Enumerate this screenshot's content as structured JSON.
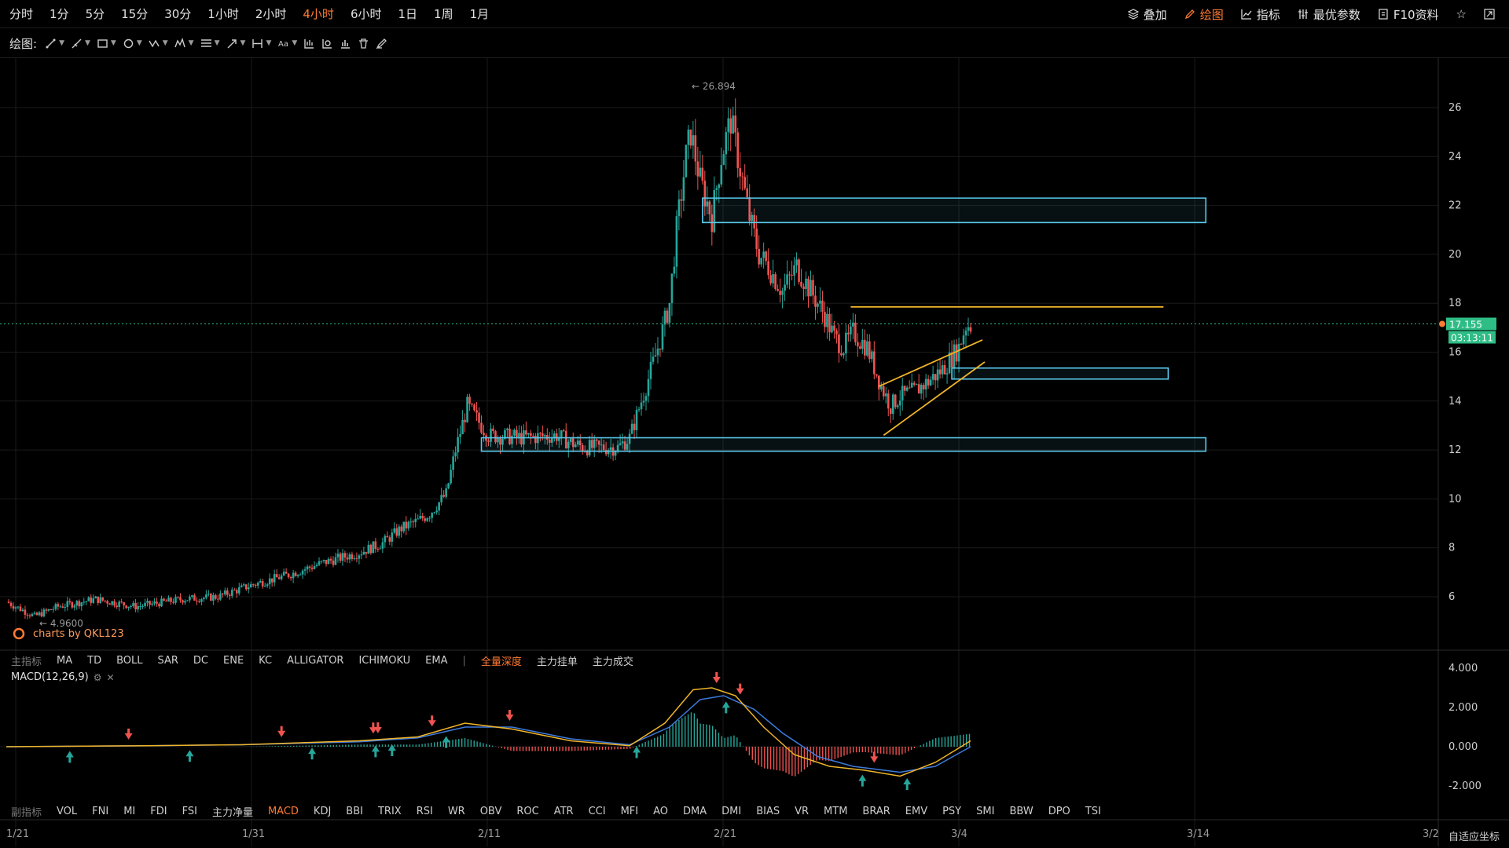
{
  "timeframes": [
    "分时",
    "1分",
    "5分",
    "15分",
    "30分",
    "1小时",
    "2小时",
    "4小时",
    "6小时",
    "1日",
    "1周",
    "1月"
  ],
  "active_timeframe_index": 7,
  "right_tools": [
    {
      "label": "叠加",
      "icon": "layers-icon",
      "active": false
    },
    {
      "label": "绘图",
      "icon": "pen-icon",
      "active": true
    },
    {
      "label": "指标",
      "icon": "indicator-chart-icon",
      "active": false
    },
    {
      "label": "最优参数",
      "icon": "sliders-icon",
      "active": false
    },
    {
      "label": "F10资料",
      "icon": "info-doc-icon",
      "active": false
    }
  ],
  "draw_label": "绘图:",
  "draw_tools": [
    {
      "icon": "line-tool-icon",
      "dropdown": true
    },
    {
      "icon": "ray-tool-icon",
      "dropdown": true
    },
    {
      "icon": "rectangle-tool-icon",
      "dropdown": true
    },
    {
      "icon": "circle-tool-icon",
      "dropdown": true
    },
    {
      "icon": "pattern-tool-icon",
      "dropdown": true
    },
    {
      "icon": "elliott-wave-icon",
      "dropdown": true
    },
    {
      "icon": "fib-tool-icon",
      "dropdown": true
    },
    {
      "icon": "arrow-tool-icon",
      "dropdown": true
    },
    {
      "icon": "measure-tool-icon",
      "dropdown": true
    },
    {
      "icon": "text-tool-icon",
      "label": "Aa",
      "dropdown": true
    },
    {
      "icon": "long-position-icon",
      "dropdown": false
    },
    {
      "icon": "short-position-icon",
      "dropdown": false
    },
    {
      "icon": "bars-pattern-icon",
      "dropdown": false
    },
    {
      "icon": "trash-icon",
      "dropdown": false
    },
    {
      "icon": "brush-icon",
      "dropdown": false
    }
  ],
  "colors": {
    "up": "#26a69a",
    "down": "#ef5350",
    "zone": "#5ac8ea",
    "trend": "#f0b429",
    "accent": "#ff7a33",
    "price": "#2ebd85"
  },
  "chart_data": {
    "type": "candlestick",
    "timeframe": "4小时",
    "x_tick_labels": [
      "1/21",
      "1/31",
      "2/11",
      "2/21",
      "3/4",
      "3/14",
      "3/2"
    ],
    "y_tick_labels": [
      "26",
      "24",
      "22",
      "20",
      "18",
      "16",
      "14",
      "12",
      "10",
      "8",
      "6"
    ],
    "ylim": [
      4.3,
      27.8
    ],
    "last_price": "17.155",
    "countdown": "03:13:11",
    "high_annotation": "26.894",
    "low_annotation": "4.9600",
    "watermark": "charts by QKL123",
    "price_path": [
      [
        0,
        5.8
      ],
      [
        12,
        5.2
      ],
      [
        22,
        5.6
      ],
      [
        38,
        5.9
      ],
      [
        55,
        5.6
      ],
      [
        75,
        5.9
      ],
      [
        90,
        6.0
      ],
      [
        105,
        6.5
      ],
      [
        120,
        6.9
      ],
      [
        135,
        7.4
      ],
      [
        150,
        7.8
      ],
      [
        160,
        8.2
      ],
      [
        168,
        8.8
      ],
      [
        175,
        9.1
      ],
      [
        180,
        9.4
      ],
      [
        187,
        10.2
      ],
      [
        191,
        12.0
      ],
      [
        196,
        13.8
      ],
      [
        205,
        12.6
      ],
      [
        220,
        12.5
      ],
      [
        234,
        12.6
      ],
      [
        240,
        12.3
      ],
      [
        246,
        12.1
      ],
      [
        260,
        12.1
      ],
      [
        265,
        12.5
      ],
      [
        272,
        14.6
      ],
      [
        278,
        16.5
      ],
      [
        282,
        18.0
      ],
      [
        285,
        21.0
      ],
      [
        289,
        24.0
      ],
      [
        291,
        25.0
      ],
      [
        295,
        23.0
      ],
      [
        300,
        21.5
      ],
      [
        304,
        24.0
      ],
      [
        308,
        25.5
      ],
      [
        312,
        23.5
      ],
      [
        316,
        21.5
      ],
      [
        320,
        20.0
      ],
      [
        324,
        19.5
      ],
      [
        330,
        18.5
      ],
      [
        336,
        19.5
      ],
      [
        342,
        18.5
      ],
      [
        348,
        17.5
      ],
      [
        352,
        16.6
      ],
      [
        356,
        16.2
      ],
      [
        360,
        16.8
      ],
      [
        366,
        16.2
      ],
      [
        372,
        14.6
      ],
      [
        376,
        13.8
      ],
      [
        380,
        14.2
      ],
      [
        386,
        14.4
      ],
      [
        392,
        14.8
      ],
      [
        398,
        15.3
      ],
      [
        402,
        15.8
      ],
      [
        405,
        16.2
      ],
      [
        408,
        17.1
      ]
    ],
    "price_path_x_range": [
      0,
      410
    ],
    "overlays": {
      "zones": [
        {
          "x0": 296,
          "x1": 510,
          "y0": 21.3,
          "y1": 22.3
        },
        {
          "x0": 202,
          "x1": 510,
          "y0": 11.95,
          "y1": 12.5
        },
        {
          "x0": 402,
          "x1": 494,
          "y0": 14.9,
          "y1": 15.35
        }
      ],
      "lines": [
        {
          "x0": 359,
          "y0": 17.85,
          "x1": 492,
          "y1": 17.85
        },
        {
          "x0": 373,
          "y0": 12.6,
          "x1": 416,
          "y1": 15.6
        },
        {
          "x0": 371,
          "y0": 14.6,
          "x1": 415,
          "y1": 16.5
        }
      ]
    },
    "indicator_bar_top": [
      "主指标",
      "MA",
      "TD",
      "BOLL",
      "SAR",
      "DC",
      "ENE",
      "KC",
      "ALLIGATOR",
      "ICHIMOKU",
      "EMA",
      "|",
      "全量深度",
      "主力挂单",
      "主力成交"
    ],
    "indicator_bar_top_active": "全量深度",
    "macd": {
      "label": "MACD(12,26,9)",
      "y_tick_labels": [
        "4.000",
        "2.000",
        "0.000",
        "-2.000"
      ],
      "ylim": [
        -2.6,
        4.4
      ],
      "dif_path": [
        [
          0,
          0
        ],
        [
          60,
          0.05
        ],
        [
          100,
          0.1
        ],
        [
          150,
          0.3
        ],
        [
          175,
          0.5
        ],
        [
          195,
          1.2
        ],
        [
          215,
          0.9
        ],
        [
          240,
          0.3
        ],
        [
          265,
          0.05
        ],
        [
          280,
          1.2
        ],
        [
          292,
          2.9
        ],
        [
          300,
          3.0
        ],
        [
          310,
          2.6
        ],
        [
          322,
          1.0
        ],
        [
          335,
          -0.4
        ],
        [
          350,
          -1.0
        ],
        [
          365,
          -1.2
        ],
        [
          380,
          -1.5
        ],
        [
          395,
          -0.8
        ],
        [
          410,
          0.3
        ]
      ],
      "dea_path": [
        [
          0,
          0
        ],
        [
          60,
          0.05
        ],
        [
          100,
          0.1
        ],
        [
          150,
          0.25
        ],
        [
          175,
          0.45
        ],
        [
          195,
          1.0
        ],
        [
          215,
          1.0
        ],
        [
          240,
          0.4
        ],
        [
          265,
          0.1
        ],
        [
          282,
          1.0
        ],
        [
          295,
          2.4
        ],
        [
          305,
          2.6
        ],
        [
          318,
          1.9
        ],
        [
          330,
          0.7
        ],
        [
          345,
          -0.5
        ],
        [
          360,
          -1.0
        ],
        [
          380,
          -1.3
        ],
        [
          395,
          -1.0
        ],
        [
          410,
          0.0
        ]
      ],
      "sell_arrows_x": [
        52,
        117,
        156,
        158,
        181,
        214,
        302,
        312,
        369
      ],
      "buy_arrows_x": [
        27,
        78,
        130,
        157,
        164,
        187,
        268,
        306,
        364,
        383
      ]
    },
    "indicator_bar_bottom": [
      "副指标",
      "VOL",
      "FNI",
      "MI",
      "FDI",
      "FSI",
      "主力净量",
      "MACD",
      "KDJ",
      "BBI",
      "TRIX",
      "RSI",
      "WR",
      "OBV",
      "ROC",
      "ATR",
      "CCI",
      "MFI",
      "AO",
      "DMA",
      "DMI",
      "BIAS",
      "VR",
      "MTM",
      "BRAR",
      "EMV",
      "PSY",
      "SMI",
      "BBW",
      "DPO",
      "TSI"
    ],
    "indicator_bar_bottom_active": "MACD"
  },
  "autoscale_label": "自适应坐标"
}
